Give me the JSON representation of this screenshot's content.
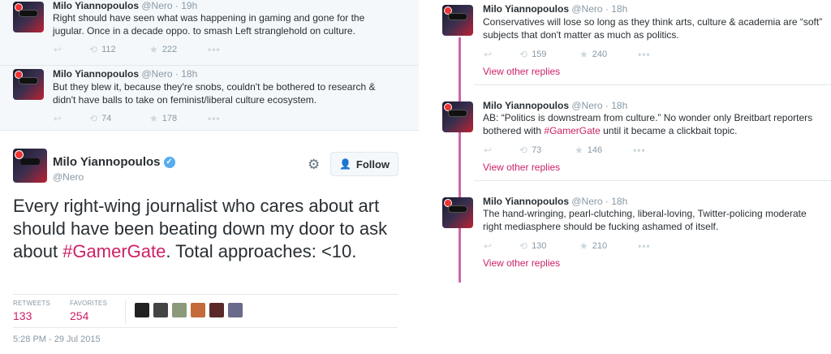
{
  "reply_tweets": [
    {
      "name": "Milo Yiannopoulos",
      "handle": "@Nero",
      "time": "19h",
      "text": "Right should have seen what was happening in gaming and gone for the jugular. Once in a decade oppo. to smash Left stranglehold on culture.",
      "retweets": "112",
      "favorites": "222"
    },
    {
      "name": "Milo Yiannopoulos",
      "handle": "@Nero",
      "time": "18h",
      "text": "But they blew it, because they're snobs, couldn't be bothered to research & didn't have balls to take on feminist/liberal culture ecosystem.",
      "retweets": "74",
      "favorites": "178"
    }
  ],
  "main_tweet": {
    "name": "Milo Yiannopoulos",
    "handle": "@Nero",
    "text_before": "Every right-wing journalist who cares about art should have been beating down my door to ask about ",
    "hashtag": "#GamerGate",
    "text_after": ". Total approaches: <10.",
    "follow_label": "Follow",
    "retweets_label": "RETWEETS",
    "retweets": "133",
    "favorites_label": "FAVORITES",
    "favorites": "254",
    "timestamp": "5:28 PM - 29 Jul 2015"
  },
  "right_tweets": [
    {
      "name": "Milo Yiannopoulos",
      "handle": "@Nero",
      "time": "18h",
      "text": "Conservatives will lose so long as they think arts, culture & academia are “soft” subjects that don't matter as much as politics.",
      "retweets": "159",
      "favorites": "240",
      "view_replies": "View other replies"
    },
    {
      "name": "Milo Yiannopoulos",
      "handle": "@Nero",
      "time": "18h",
      "text_before": "AB: “Politics is downstream from culture.” No wonder only Breitbart reporters bothered with ",
      "hashtag": "#GamerGate",
      "text_after": " until it became a clickbait topic.",
      "retweets": "73",
      "favorites": "146",
      "view_replies": "View other replies"
    },
    {
      "name": "Milo Yiannopoulos",
      "handle": "@Nero",
      "time": "18h",
      "text": "The hand-wringing, pearl-clutching, liberal-loving, Twitter-policing moderate right mediasphere should be fucking ashamed of itself.",
      "retweets": "130",
      "favorites": "210",
      "view_replies": "View other replies"
    }
  ],
  "icons": {
    "reply": "reply-icon",
    "retweet": "retweet-icon",
    "favorite": "star-icon",
    "more": "more-icon",
    "verified": "verified-icon",
    "settings": "gear-icon",
    "follow": "follow-icon"
  },
  "colors": {
    "accent": "#cc2266",
    "thread_line": "#cc66aa",
    "meta": "#8899a6",
    "verified": "#55acee"
  }
}
